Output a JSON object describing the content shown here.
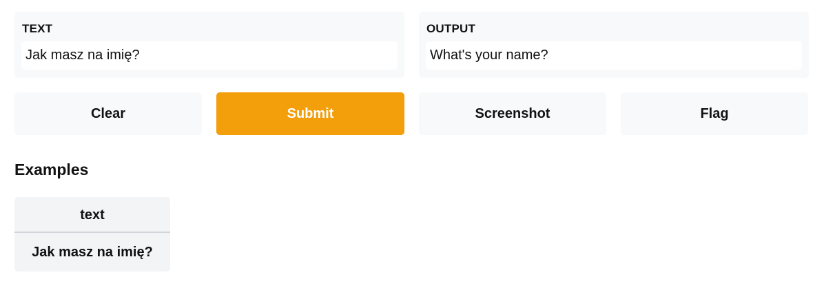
{
  "input_panel": {
    "label": "TEXT",
    "value": "Jak masz na imię?"
  },
  "output_panel": {
    "label": "OUTPUT",
    "value": "What's your name?"
  },
  "buttons": {
    "clear": "Clear",
    "submit": "Submit",
    "screenshot": "Screenshot",
    "flag": "Flag"
  },
  "examples": {
    "title": "Examples",
    "column_header": "text",
    "rows": [
      "Jak masz na imię?"
    ]
  },
  "colors": {
    "accent": "#f39e0b",
    "panel_background": "#f8f9fa",
    "table_background": "#f3f4f6"
  }
}
